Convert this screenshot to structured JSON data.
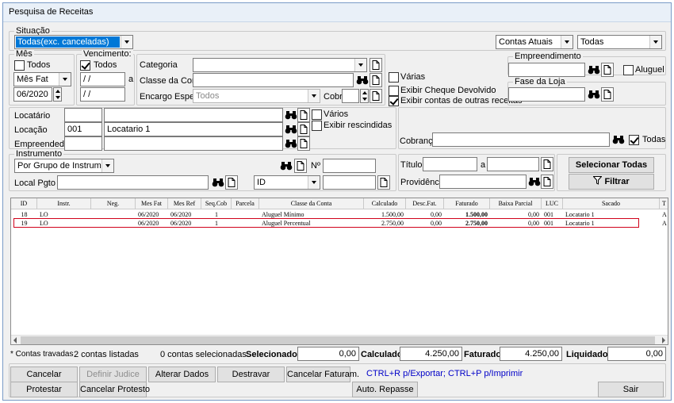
{
  "window": {
    "title": "Pesquisa de Receitas"
  },
  "situacao": {
    "label": "Situação",
    "value": "Todas(exc. canceladas)"
  },
  "top_right": {
    "contas": "Contas Atuais",
    "todas": "Todas"
  },
  "mes": {
    "label": "Mês",
    "todos_label": "Todos",
    "todos_checked": false,
    "tipo": "Mês Fat",
    "valor": "06/2020"
  },
  "vencimento": {
    "label": "Vencimento:",
    "todos_label": "Todos",
    "todos_checked": true,
    "de": " / /",
    "sep": "a",
    "ate": " / /"
  },
  "categoria": {
    "label": "Categoria",
    "value": ""
  },
  "classe_conta": {
    "label": "Classe da Conta",
    "value": ""
  },
  "encargo": {
    "label": "Encargo Espec.",
    "value": "Todos",
    "cobr_label": "Cobr",
    "cobr_value": ""
  },
  "options": {
    "varias_label": "Várias",
    "varias_checked": false,
    "cheque_label": "Exibir Cheque Devolvido",
    "cheque_checked": false,
    "outras_label": "Exibir contas de outras receitas",
    "outras_checked": true
  },
  "empreendimento": {
    "label": "Empreendimento",
    "value": "",
    "aluguel_label": "Aluguel",
    "aluguel_checked": false
  },
  "fase_loja": {
    "label": "Fase da Loja",
    "value": ""
  },
  "locatario": {
    "label": "Locatário",
    "code": "",
    "name": "",
    "varios_label": "Vários",
    "varios_checked": false
  },
  "locacao": {
    "label": "Locação",
    "code": "001",
    "name": "Locatario 1",
    "rescindidas_label": "Exibir rescindidas",
    "rescindidas_checked": false
  },
  "empreendedor": {
    "label": "Empreendedor",
    "code": "",
    "name": ""
  },
  "cobranca": {
    "label": "Cobrança",
    "value": "",
    "todas_label": "Todas",
    "todas_checked": true
  },
  "instrumento": {
    "label": "Instrumento",
    "value": "Por Grupo de Instrumento",
    "num_label": "Nº",
    "num_value": ""
  },
  "titulo": {
    "label": "Título",
    "de": "",
    "sep": "a",
    "ate": ""
  },
  "local_pgto": {
    "label": "Local Pgto",
    "value": "",
    "id_value": "ID",
    "id_text": ""
  },
  "providencia": {
    "label": "Providência",
    "value": ""
  },
  "buttons": {
    "selecionar_todas": "Selecionar Todas",
    "filtrar": "Filtrar"
  },
  "grid": {
    "headers": [
      "ID",
      "Instr.",
      "Neg.",
      "Mes Fat",
      "Mes Ref",
      "Seq.Cob",
      "Parcela",
      "Classe da Conta",
      "Calculado",
      "Desc.Fat.",
      "Faturado",
      "Baixa Parcial",
      "LUC",
      "Sacado",
      "T"
    ],
    "rows": [
      [
        "18",
        "LO",
        "",
        "06/2020",
        "06/2020",
        "1",
        "",
        "Aluguel Mínimo",
        "1.500,00",
        "0,00",
        "1.500,00",
        "0,00",
        "001",
        "Locatario 1",
        "A"
      ],
      [
        "19",
        "LO",
        "",
        "06/2020",
        "06/2020",
        "1",
        "",
        "Aluguel Percentual",
        "2.750,00",
        "0,00",
        "2.750,00",
        "0,00",
        "001",
        "Locatario 1",
        "A"
      ]
    ]
  },
  "summary": {
    "travadas": "* Contas travadas",
    "listadas": "2 contas listadas",
    "selecionadas": "0 contas selecionadas",
    "selecionado_label": "Selecionado",
    "selecionado_value": "0,00",
    "calculado_label": "Calculado",
    "calculado_value": "4.250,00",
    "faturado_label": "Faturado",
    "faturado_value": "4.250,00",
    "liquidado_label": "Liquidado",
    "liquidado_value": "0,00"
  },
  "actions": {
    "cancelar": "Cancelar",
    "definir_judice": "Definir Judice",
    "alterar_dados": "Alterar Dados",
    "destravar": "Destravar",
    "cancelar_faturam": "Cancelar Faturam.",
    "protestar": "Protestar",
    "cancelar_protesto": "Cancelar Protesto",
    "auto_repasse": "Auto. Repasse",
    "sair": "Sair",
    "hint": "CTRL+R p/Exportar; CTRL+P p/Imprimir"
  },
  "colors": {
    "selection": "#0078d7",
    "highlight_border": "#d0021b",
    "hint": "#0000c8"
  }
}
